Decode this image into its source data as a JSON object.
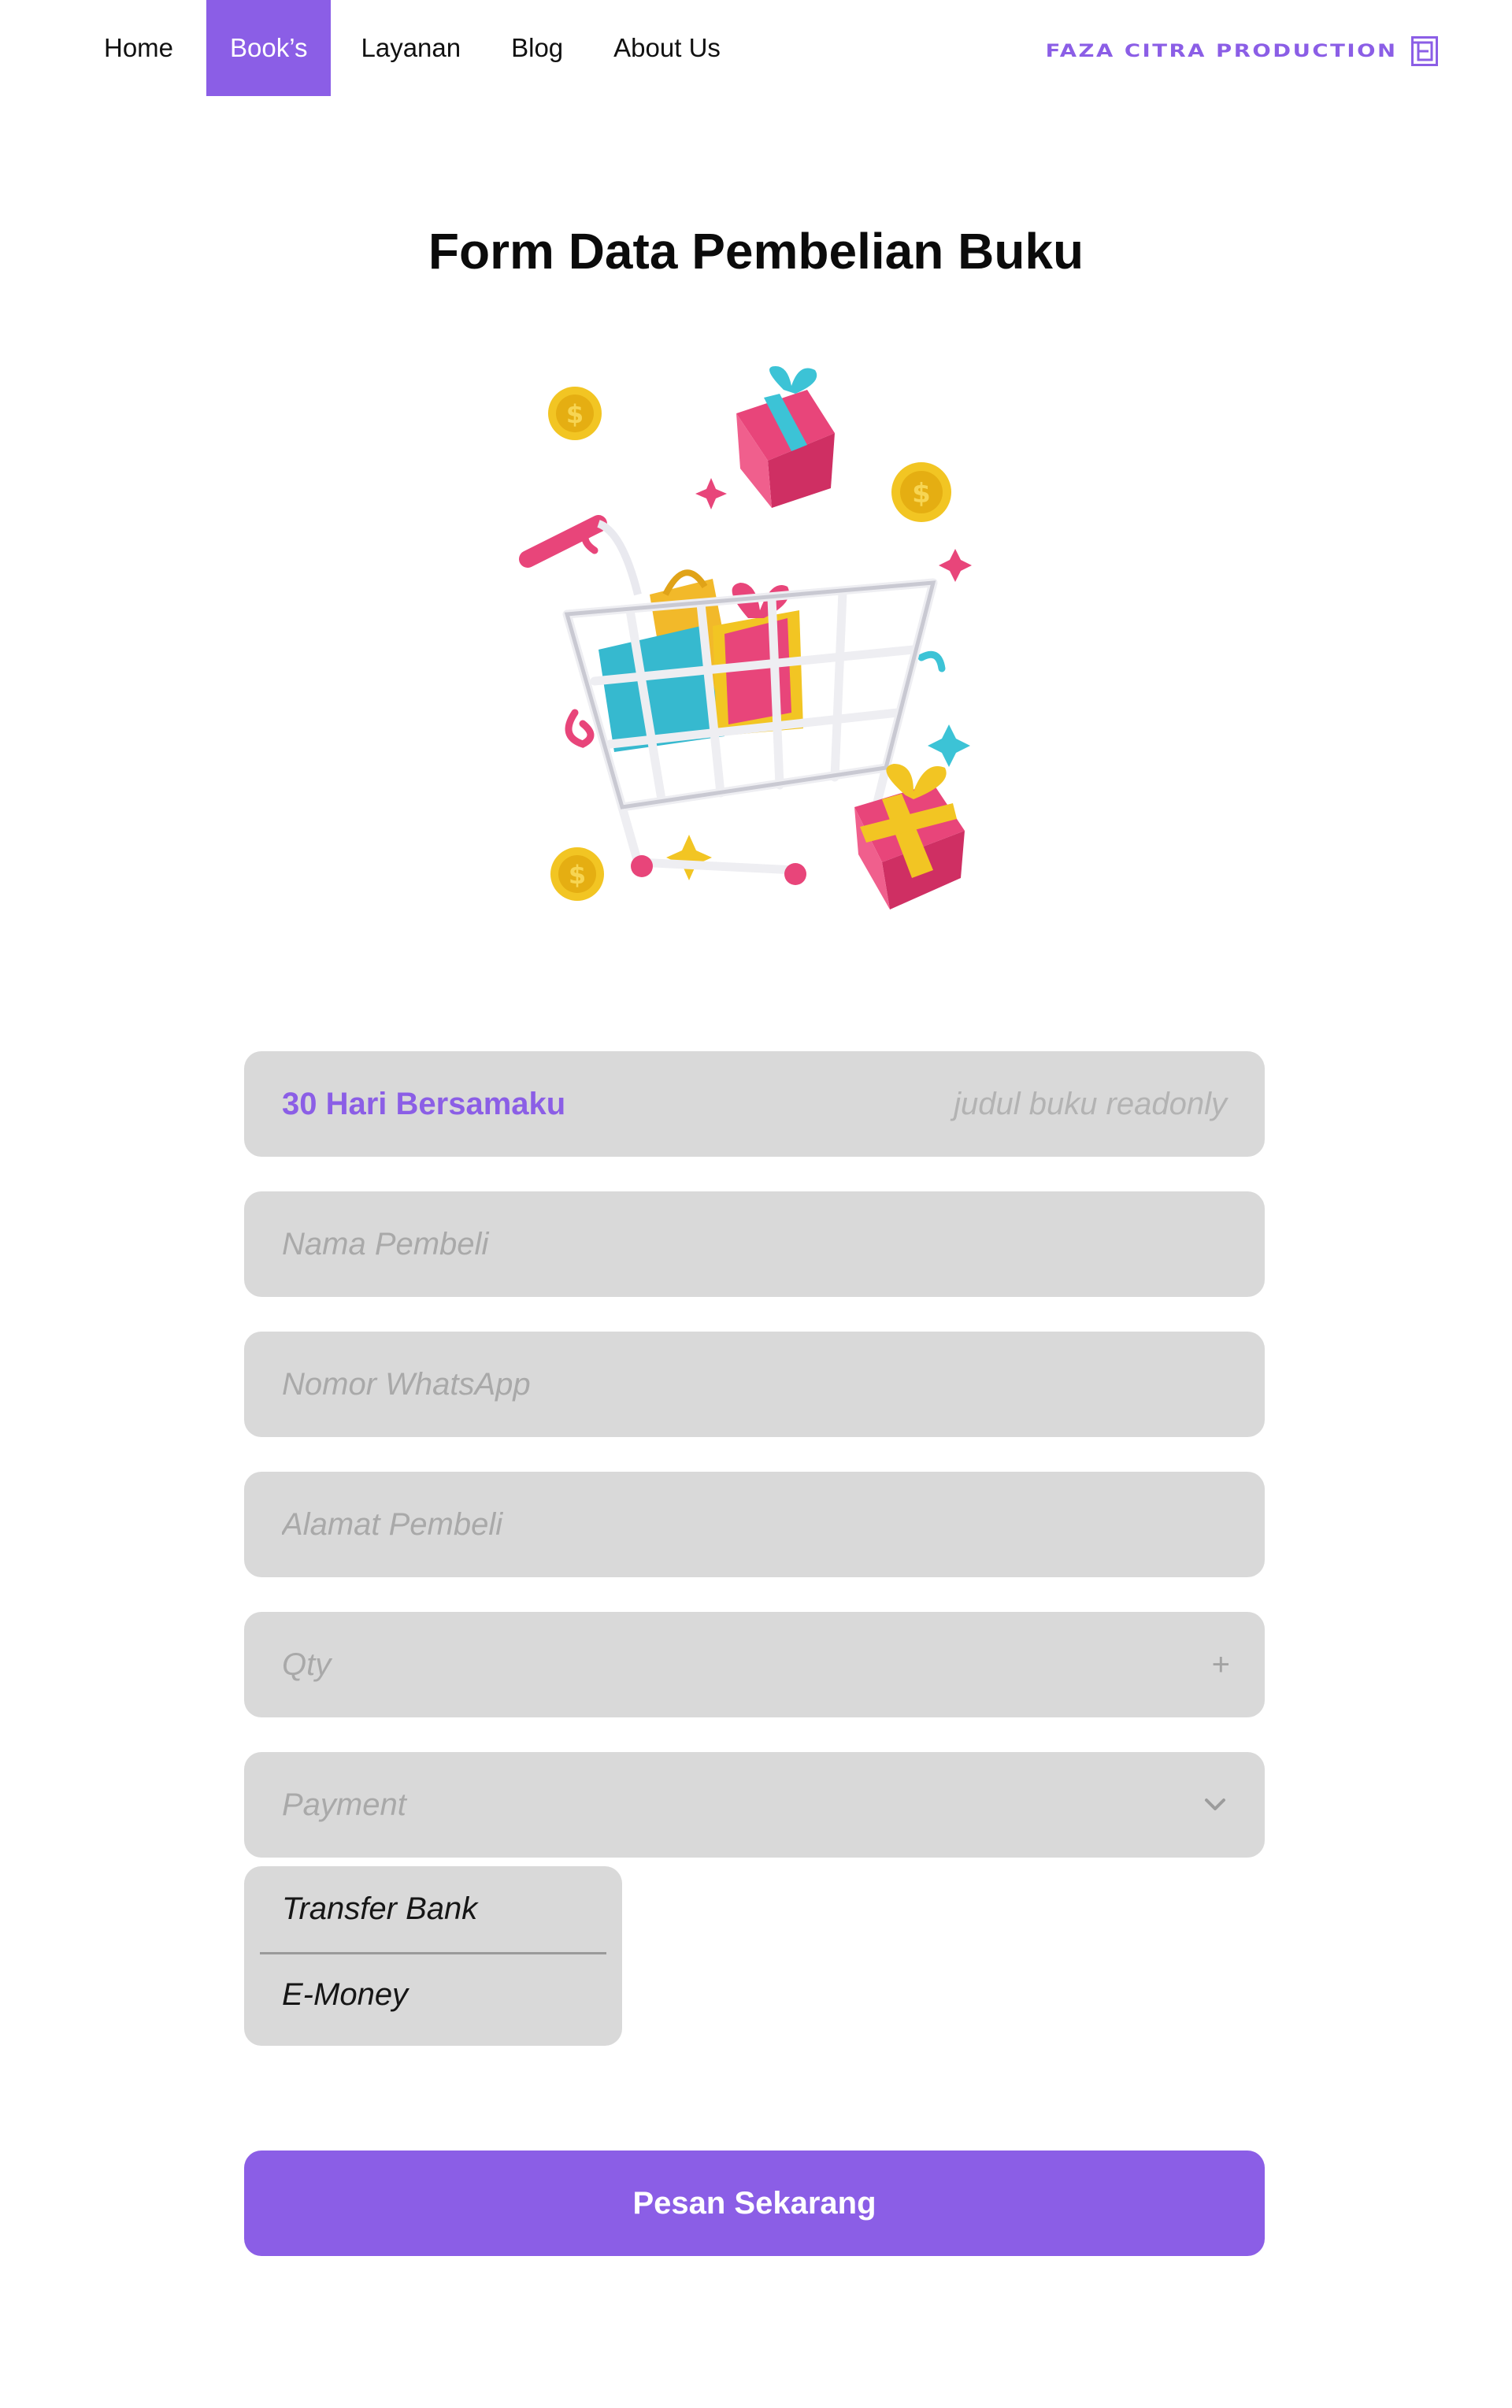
{
  "nav": {
    "items": [
      {
        "label": "Home"
      },
      {
        "label": "Book’s",
        "active": true
      },
      {
        "label": "Layanan"
      },
      {
        "label": "Blog"
      },
      {
        "label": "About Us"
      }
    ],
    "brand": "FAZA CITRA PRODUCTION",
    "brand_logo_icon": "fcp-logo-icon"
  },
  "page": {
    "title": "Form Data Pembelian Buku",
    "illustration_icon": "shopping-cart-gifts-icon"
  },
  "form": {
    "book_title": {
      "value": "30 Hari Bersamaku",
      "hint": "judul buku readonly"
    },
    "buyer_name": {
      "placeholder": "Nama Pembeli"
    },
    "whatsapp": {
      "placeholder": "Nomor WhatsApp"
    },
    "address": {
      "placeholder": "Alamat Pembeli"
    },
    "qty": {
      "placeholder": "Qty",
      "increment_icon": "plus-icon",
      "increment_symbol": "+"
    },
    "payment": {
      "placeholder": "Payment",
      "chevron_icon": "chevron-down-icon",
      "options": [
        "Transfer Bank",
        "E-Money"
      ]
    },
    "submit_label": "Pesan Sekarang"
  },
  "colors": {
    "accent": "#8b5ee6",
    "field_bg": "#d9d9d9",
    "placeholder": "#a9a9a9"
  }
}
